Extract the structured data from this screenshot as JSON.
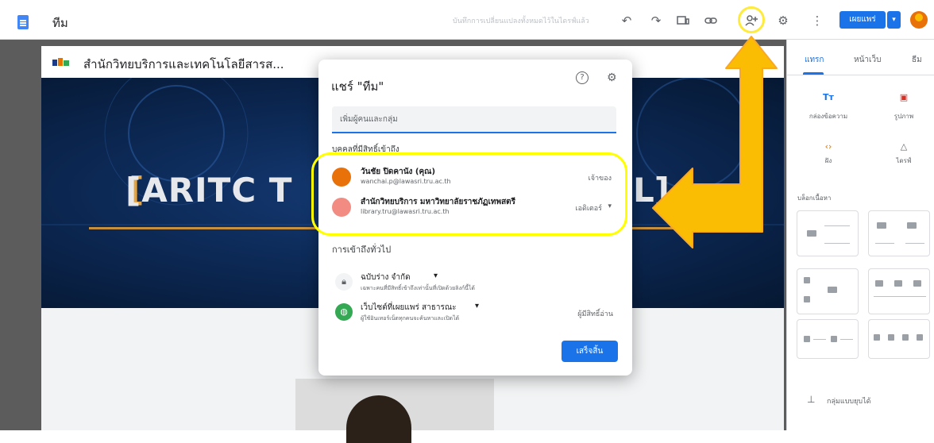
{
  "topbar": {
    "site_title": "ทีม",
    "save_status": "บันทึกการเปลี่ยนแปลงทั้งหมดไว้ในไดรฟ์แล้ว",
    "publish_label": "เผยแพร่",
    "icons": [
      "undo-icon",
      "redo-icon",
      "preview-icon",
      "link-icon",
      "share-icon",
      "settings-icon",
      "more-icon"
    ]
  },
  "page": {
    "org_title": "สำนักวิทยบริการและเทคโนโลยีสารส...",
    "banner_left": "[ARITC T",
    "banner_right": "L]"
  },
  "right_panel": {
    "tabs": [
      "แทรก",
      "หน้าเว็บ",
      "ธีม"
    ],
    "tools": [
      {
        "icon": "text-box-icon",
        "label": "กล่องข้อความ"
      },
      {
        "icon": "image-icon",
        "label": "รูปภาพ"
      },
      {
        "icon": "embed-icon",
        "label": "ฝัง"
      },
      {
        "icon": "drive-icon",
        "label": "ไดรฟ์"
      }
    ],
    "layouts_label": "บล็อกเนื้อหา",
    "collapsible_label": "กลุ่มแบบยุบได้"
  },
  "share_dialog": {
    "title": "แชร์ \"ทีม\"",
    "input_placeholder": "เพิ่มผู้คนและกลุ่ม",
    "people_heading": "บุคคลที่มีสิทธิ์เข้าถึง",
    "people": [
      {
        "name": "วันชัย ปิดคานัง (คุณ)",
        "email": "wanchai.p@lawasri.tru.ac.th",
        "role": "เจ้าของ",
        "avatar_color": "#e8710a"
      },
      {
        "name": "สำนักวิทยบริการ มหาวิทยาลัยราชภัฏเทพสตรี",
        "email": "library.tru@lawasri.tru.ac.th",
        "role": "เอดิเตอร์",
        "avatar_color": "#f28b82"
      }
    ],
    "general_heading": "การเข้าถึงทั่วไป",
    "access": [
      {
        "main": "ฉบับร่าง  จำกัด",
        "sub": "เฉพาะคนที่มีสิทธิ์เข้าถึงเท่านั้นที่เปิดด้วยลิงก์นี้ได้",
        "role": "",
        "icon": "lock-icon"
      },
      {
        "main": "เว็บไซต์ที่เผยแพร่  สาธารณะ",
        "sub": "ผู้ใช้อินเทอร์เน็ตทุกคนจะค้นหาและเปิดได้",
        "role": "ผู้มีสิทธิ์อ่าน",
        "icon": "globe-icon"
      }
    ],
    "done_label": "เสร็จสิ้น"
  },
  "colors": {
    "accent": "#1a73e8",
    "highlight": "#ffff00",
    "arrow": "#fbbc04"
  }
}
